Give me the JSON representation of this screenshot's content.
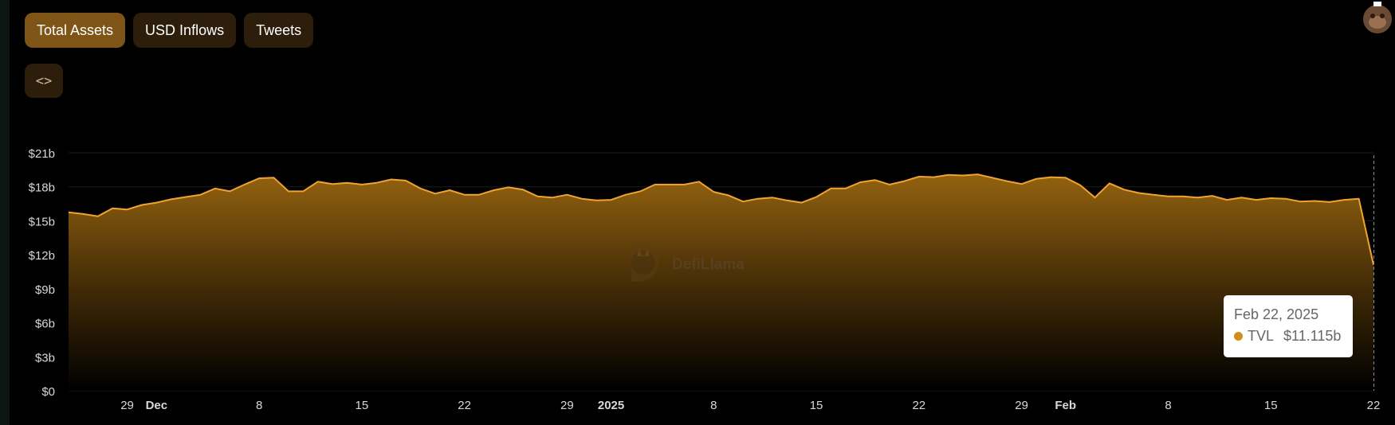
{
  "tabs": [
    {
      "label": "Total Assets",
      "active": true
    },
    {
      "label": "USD Inflows",
      "active": false
    },
    {
      "label": "Tweets",
      "active": false
    }
  ],
  "embed_button": {
    "icon": "code-icon",
    "glyph": "<>"
  },
  "watermark": {
    "text": "DefiLlama"
  },
  "tooltip": {
    "date": "Feb 22, 2025",
    "series": "TVL",
    "value": "$11.115b"
  },
  "colors": {
    "line": "#f0a332",
    "fill_top": "#93620f",
    "tab_active": "#7f5417",
    "tab_inactive": "#2c1e0a",
    "tooltip_dot": "#d08e1b"
  },
  "chart_data": {
    "type": "area",
    "y_tick_labels": [
      "$0",
      "$3b",
      "$6b",
      "$9b",
      "$12b",
      "$15b",
      "$18b",
      "$21b"
    ],
    "x_tick_labels": [
      {
        "date": "2024-11-29",
        "label": "29",
        "bold": false
      },
      {
        "date": "2024-12-01",
        "label": "Dec",
        "bold": true
      },
      {
        "date": "2024-12-08",
        "label": "8",
        "bold": false
      },
      {
        "date": "2024-12-15",
        "label": "15",
        "bold": false
      },
      {
        "date": "2024-12-22",
        "label": "22",
        "bold": false
      },
      {
        "date": "2024-12-29",
        "label": "29",
        "bold": false
      },
      {
        "date": "2025-01-01",
        "label": "2025",
        "bold": true
      },
      {
        "date": "2025-01-08",
        "label": "8",
        "bold": false
      },
      {
        "date": "2025-01-15",
        "label": "15",
        "bold": false
      },
      {
        "date": "2025-01-22",
        "label": "22",
        "bold": false
      },
      {
        "date": "2025-01-29",
        "label": "29",
        "bold": false
      },
      {
        "date": "2025-02-01",
        "label": "Feb",
        "bold": true
      },
      {
        "date": "2025-02-08",
        "label": "8",
        "bold": false
      },
      {
        "date": "2025-02-15",
        "label": "15",
        "bold": false
      },
      {
        "date": "2025-02-22",
        "label": "22",
        "bold": false
      }
    ],
    "ylim": [
      0,
      21
    ],
    "y_unit": "$b",
    "x_range": [
      "2024-11-25",
      "2025-02-22"
    ],
    "grid": true,
    "series": [
      {
        "points": [
          [
            "2024-11-25",
            15.75
          ],
          [
            "2024-11-26",
            15.6
          ],
          [
            "2024-11-27",
            15.4
          ],
          [
            "2024-11-28",
            16.1
          ],
          [
            "2024-11-29",
            16.0
          ],
          [
            "2024-11-30",
            16.4
          ],
          [
            "2024-12-01",
            16.6
          ],
          [
            "2024-12-02",
            16.9
          ],
          [
            "2024-12-03",
            17.1
          ],
          [
            "2024-12-04",
            17.3
          ],
          [
            "2024-12-05",
            17.85
          ],
          [
            "2024-12-06",
            17.6
          ],
          [
            "2024-12-07",
            18.2
          ],
          [
            "2024-12-08",
            18.75
          ],
          [
            "2024-12-09",
            18.8
          ],
          [
            "2024-12-10",
            17.6
          ],
          [
            "2024-12-11",
            17.6
          ],
          [
            "2024-12-12",
            18.45
          ],
          [
            "2024-12-13",
            18.25
          ],
          [
            "2024-12-14",
            18.35
          ],
          [
            "2024-12-15",
            18.2
          ],
          [
            "2024-12-16",
            18.35
          ],
          [
            "2024-12-17",
            18.65
          ],
          [
            "2024-12-18",
            18.55
          ],
          [
            "2024-12-19",
            17.85
          ],
          [
            "2024-12-20",
            17.4
          ],
          [
            "2024-12-21",
            17.7
          ],
          [
            "2024-12-22",
            17.3
          ],
          [
            "2024-12-23",
            17.3
          ],
          [
            "2024-12-24",
            17.7
          ],
          [
            "2024-12-25",
            17.95
          ],
          [
            "2024-12-26",
            17.75
          ],
          [
            "2024-12-27",
            17.15
          ],
          [
            "2024-12-28",
            17.05
          ],
          [
            "2024-12-29",
            17.3
          ],
          [
            "2024-12-30",
            16.95
          ],
          [
            "2024-12-31",
            16.8
          ],
          [
            "2025-01-01",
            16.85
          ],
          [
            "2025-01-02",
            17.3
          ],
          [
            "2025-01-03",
            17.6
          ],
          [
            "2025-01-04",
            18.2
          ],
          [
            "2025-01-05",
            18.2
          ],
          [
            "2025-01-06",
            18.2
          ],
          [
            "2025-01-07",
            18.45
          ],
          [
            "2025-01-08",
            17.55
          ],
          [
            "2025-01-09",
            17.25
          ],
          [
            "2025-01-10",
            16.7
          ],
          [
            "2025-01-11",
            16.95
          ],
          [
            "2025-01-12",
            17.05
          ],
          [
            "2025-01-13",
            16.8
          ],
          [
            "2025-01-14",
            16.6
          ],
          [
            "2025-01-15",
            17.1
          ],
          [
            "2025-01-16",
            17.85
          ],
          [
            "2025-01-17",
            17.85
          ],
          [
            "2025-01-18",
            18.4
          ],
          [
            "2025-01-19",
            18.6
          ],
          [
            "2025-01-20",
            18.2
          ],
          [
            "2025-01-21",
            18.5
          ],
          [
            "2025-01-22",
            18.9
          ],
          [
            "2025-01-23",
            18.85
          ],
          [
            "2025-01-24",
            19.05
          ],
          [
            "2025-01-25",
            19.0
          ],
          [
            "2025-01-26",
            19.1
          ],
          [
            "2025-01-27",
            18.8
          ],
          [
            "2025-01-28",
            18.5
          ],
          [
            "2025-01-29",
            18.25
          ],
          [
            "2025-01-30",
            18.7
          ],
          [
            "2025-01-31",
            18.85
          ],
          [
            "2025-02-01",
            18.8
          ],
          [
            "2025-02-02",
            18.15
          ],
          [
            "2025-02-03",
            17.05
          ],
          [
            "2025-02-04",
            18.3
          ],
          [
            "2025-02-05",
            17.75
          ],
          [
            "2025-02-06",
            17.45
          ],
          [
            "2025-02-07",
            17.3
          ],
          [
            "2025-02-08",
            17.15
          ],
          [
            "2025-02-09",
            17.15
          ],
          [
            "2025-02-10",
            17.05
          ],
          [
            "2025-02-11",
            17.2
          ],
          [
            "2025-02-12",
            16.85
          ],
          [
            "2025-02-13",
            17.05
          ],
          [
            "2025-02-14",
            16.85
          ],
          [
            "2025-02-15",
            17.0
          ],
          [
            "2025-02-16",
            16.95
          ],
          [
            "2025-02-17",
            16.7
          ],
          [
            "2025-02-18",
            16.75
          ],
          [
            "2025-02-19",
            16.65
          ],
          [
            "2025-02-20",
            16.85
          ],
          [
            "2025-02-21",
            16.95
          ],
          [
            "2025-02-22",
            11.115
          ]
        ]
      }
    ]
  }
}
